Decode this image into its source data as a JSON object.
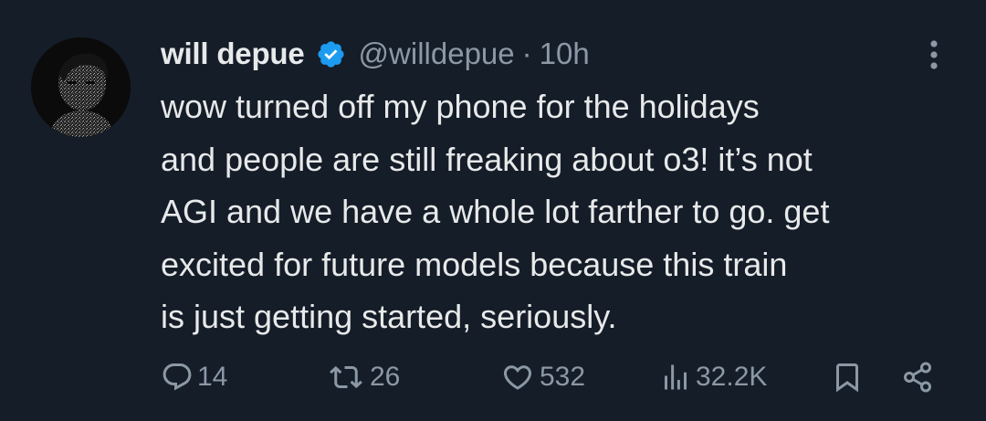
{
  "tweet": {
    "author": {
      "display_name": "will depue",
      "handle": "@willdepue",
      "verified": true,
      "avatar_icon": "avatar-photo"
    },
    "separator": "·",
    "time": "10h",
    "text_lines": [
      "wow turned off my phone for the holidays",
      "and people are still freaking about o3! it’s not",
      "AGI and we have a whole lot farther to go. get",
      "excited for future models because this train",
      "is just getting started, seriously."
    ],
    "actions": {
      "replies": "14",
      "reposts": "26",
      "likes": "532",
      "views": "32.2K"
    }
  },
  "colors": {
    "background": "#151d28",
    "text_primary": "#e7e9ea",
    "text_secondary": "#8b98a5",
    "verified_badge": "#1d9bf0"
  },
  "icons": {
    "more": "more-vertical-icon",
    "reply": "reply-icon",
    "repost": "repost-icon",
    "like": "heart-icon",
    "views": "views-icon",
    "bookmark": "bookmark-icon",
    "share": "share-icon"
  }
}
